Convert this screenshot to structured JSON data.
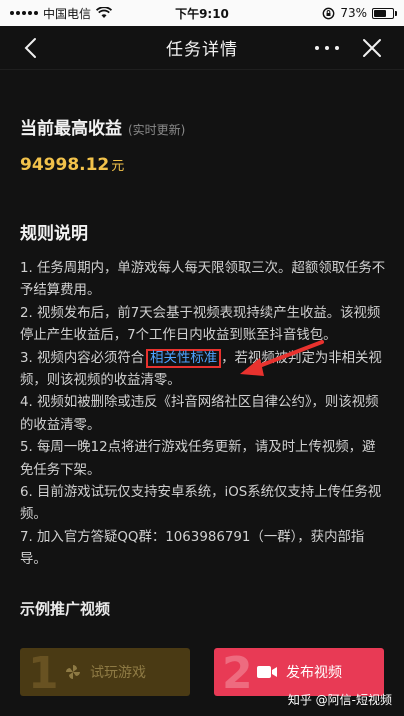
{
  "status": {
    "carrier": "中国电信",
    "time": "下午9:10",
    "battery": "73%",
    "battery_level": 0.73
  },
  "nav": {
    "title": "任务详情"
  },
  "earnings": {
    "title": "当前最高收益",
    "subtitle": "(实时更新)",
    "value": "94998.12",
    "unit": "元"
  },
  "rules": {
    "title": "规则说明",
    "r1": "1. 任务周期内，单游戏每人每天限领取三次。超额领取任务不予结算费用。",
    "r2": "2. 视频发布后，前7天会基于视频表现持续产生收益。该视频停止产生收益后，7个工作日内收益到账至抖音钱包。",
    "r3_pre": "3. 视频内容必须符合",
    "r3_link": "相关性标准",
    "r3_post": "，若视频被判定为非相关视频，则该视频的收益清零。",
    "r4": "4. 视频如被删除或违反《抖音网络社区自律公约》，则该视频的收益清零。",
    "r5": "5. 每周一晚12点将进行游戏任务更新，请及时上传视频，避免任务下架。",
    "r6": "6. 目前游戏试玩仅支持安卓系统，iOS系统仅支持上传任务视频。",
    "r7": "7. 加入官方答疑QQ群：1063986791（一群），获内部指导。"
  },
  "example": {
    "title": "示例推广视频"
  },
  "buttons": {
    "try_num": "1",
    "try_label": "试玩游戏",
    "publish_num": "2",
    "publish_label": "发布视频"
  },
  "watermark": "知乎 @阿信-短视频",
  "colors": {
    "accent_gold": "#f2c24b",
    "link_blue": "#4ea3ff",
    "highlight_red": "#e8322e",
    "publish_pink": "#e83a55"
  }
}
